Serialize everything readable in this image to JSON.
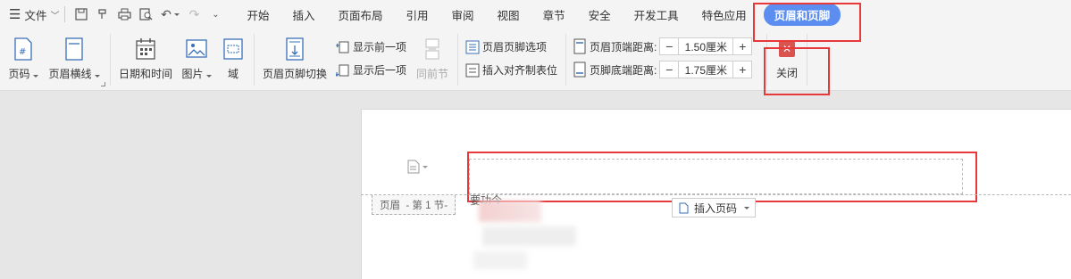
{
  "menu": {
    "file_label": "文件",
    "tabs": [
      "开始",
      "插入",
      "页面布局",
      "引用",
      "审阅",
      "视图",
      "章节",
      "安全",
      "开发工具",
      "特色应用",
      "页眉和页脚"
    ],
    "active_tab_index": 10
  },
  "ribbon": {
    "page_number": "页码",
    "header_line": "页眉横线",
    "date_time": "日期和时间",
    "picture": "图片",
    "field": "域",
    "switch_header_footer": "页眉页脚切换",
    "show_prev": "显示前一项",
    "show_next": "显示后一项",
    "prev_section": "同前节",
    "header_footer_options": "页眉页脚选项",
    "insert_align_tab": "插入对齐制表位",
    "header_top_label": "页眉顶端距离:",
    "header_top_value": "1.50厘米",
    "footer_bottom_label": "页脚底端距离:",
    "footer_bottom_value": "1.75厘米",
    "close": "关闭"
  },
  "document": {
    "header_tag": "页眉  - 第 1 节-",
    "insert_page_number": "插入页码",
    "body_fragment": "要功今"
  },
  "colors": {
    "accent": "#5b8ef0",
    "highlight_red": "#e8393a",
    "close_red": "#d9534f"
  }
}
